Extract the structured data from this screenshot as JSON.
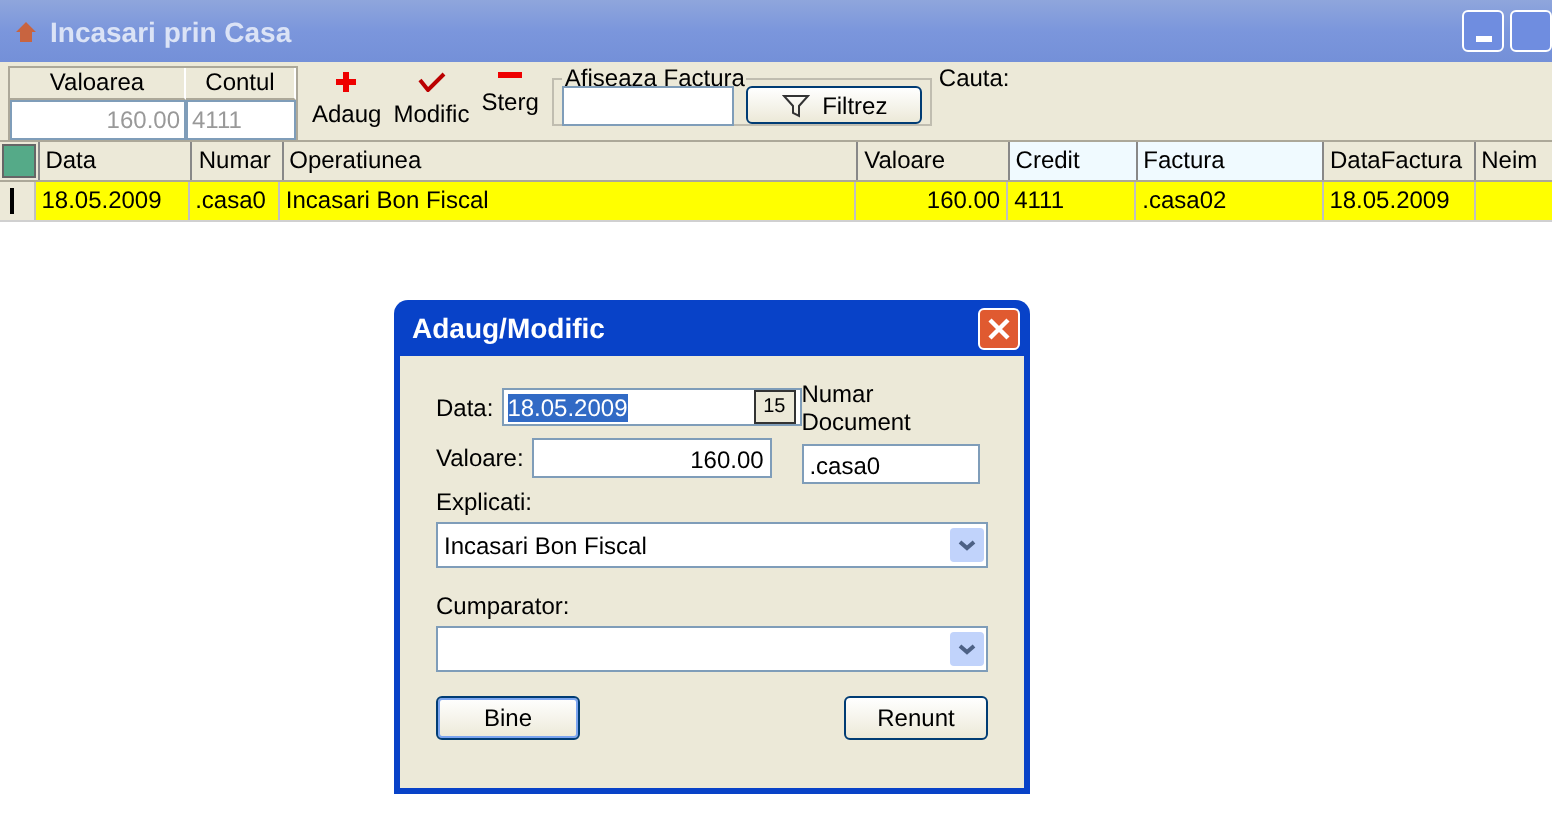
{
  "window": {
    "title": "Incasari prin Casa"
  },
  "summary": {
    "columns": [
      {
        "label": "Valoarea",
        "value": "160.00"
      },
      {
        "label": "Contul",
        "value": "4111"
      }
    ]
  },
  "toolbar": [
    {
      "kind": "add",
      "label": "Adaug"
    },
    {
      "kind": "edit",
      "label": "Modific"
    },
    {
      "kind": "delete",
      "label": "Sterg"
    }
  ],
  "invoice_filter": {
    "label": "Afiseaza Factura",
    "button": "Filtrez"
  },
  "search": {
    "label": "Cauta:"
  },
  "table": {
    "columns": [
      {
        "label": "Data",
        "highlighted": false
      },
      {
        "label": "Numar",
        "highlighted": false
      },
      {
        "label": "Operatiunea",
        "highlighted": false
      },
      {
        "label": "Valoare",
        "highlighted": false
      },
      {
        "label": "Credit",
        "highlighted": true
      },
      {
        "label": "Factura",
        "highlighted": true
      },
      {
        "label": "DataFactura",
        "highlighted": false
      },
      {
        "label": "Neim",
        "highlighted": false
      }
    ],
    "rows": [
      {
        "selected": true,
        "cells": [
          "18.05.2009",
          ".casa0",
          "Incasari Bon Fiscal",
          "160.00",
          "4111",
          ".casa02",
          "18.05.2009",
          ""
        ]
      }
    ]
  },
  "dialog": {
    "title": "Adaug/Modific",
    "date_label": "Data:",
    "date_value": "18.05.2009",
    "calendar_button": "15",
    "doc_label": "Numar Document",
    "doc_value": ".casa0",
    "amount_label": "Valoare:",
    "amount_value": "160.00",
    "explanation_label": "Explicati:",
    "explanation_value": "Incasari Bon Fiscal",
    "buyer_label": "Cumparator:",
    "ok": "Bine",
    "cancel": "Renunt"
  }
}
